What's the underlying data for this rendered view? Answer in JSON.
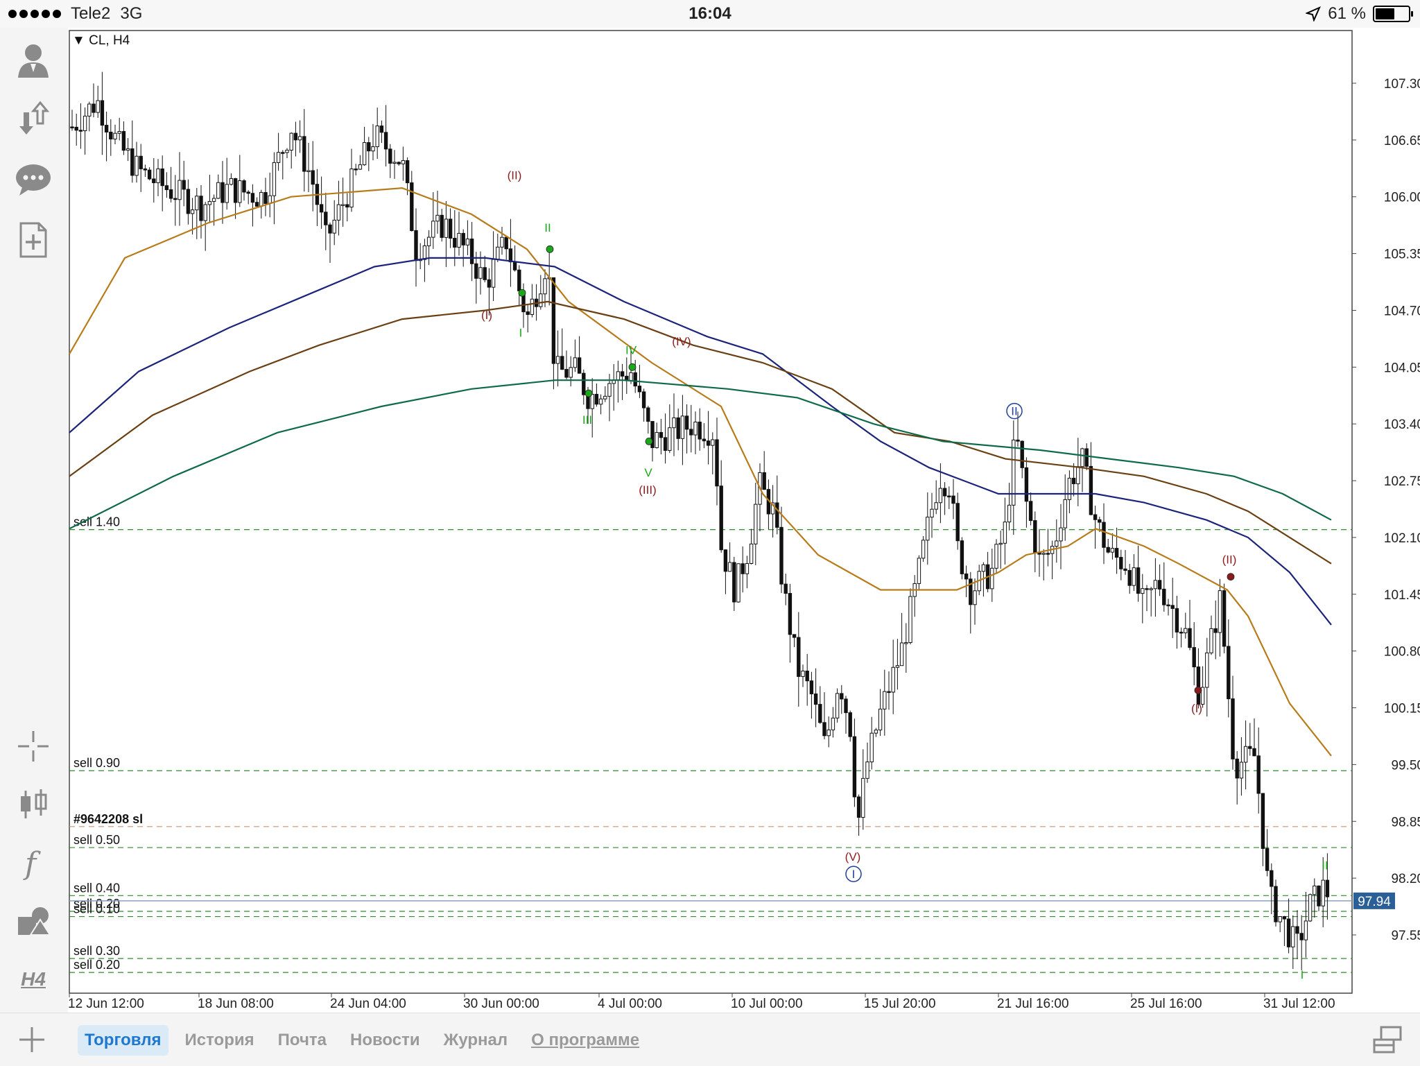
{
  "status_bar": {
    "carrier": "Tele2",
    "network": "3G",
    "time": "16:04",
    "battery": "61 %"
  },
  "chart": {
    "symbol_label": "CL, H4",
    "current_price": "97.94",
    "timeframe_button": "H4",
    "price_labels": [
      "107.30",
      "106.65",
      "106.00",
      "105.35",
      "104.70",
      "104.05",
      "103.40",
      "102.75",
      "102.10",
      "101.45",
      "100.80",
      "100.15",
      "99.50",
      "98.85",
      "98.20",
      "97.55"
    ],
    "time_labels": [
      "12 Jun 12:00",
      "18 Jun 08:00",
      "24 Jun 04:00",
      "30 Jun 00:00",
      "4 Jul 00:00",
      "10 Jul 00:00",
      "15 Jul 20:00",
      "21 Jul 16:00",
      "25 Jul 16:00",
      "31 Jul 12:00"
    ],
    "order_lines": [
      {
        "label": "sell 1.40",
        "price": 102.19
      },
      {
        "label": "sell 0.90",
        "price": 99.43
      },
      {
        "label": "#9642208 sl",
        "price": 98.79
      },
      {
        "label": "sell 0.50",
        "price": 98.55
      },
      {
        "label": "sell 0.40",
        "price": 98.0
      },
      {
        "label": "sell 0.20",
        "price": 97.82
      },
      {
        "label": "sell 0.10",
        "price": 97.76
      },
      {
        "label": "sell 0.30",
        "price": 97.28
      },
      {
        "label": "sell 0.20",
        "price": 97.12
      }
    ],
    "colors": {
      "ma_orange": "#b87b1a",
      "ma_navy": "#1b237a",
      "ma_brown": "#6a3f12",
      "ma_green": "#0f6a4c",
      "order_line": "#2f8a2f",
      "sl_line": "#d09070",
      "wave_red": "#8b1c1c",
      "wave_green": "#1aa81a",
      "wave_blue": "#1f3f9a",
      "price_tag": "#2a5f97"
    },
    "wave_labels": [
      {
        "text": "(II)",
        "color": "red"
      },
      {
        "text": "II",
        "color": "green"
      },
      {
        "text": "(I)",
        "color": "red"
      },
      {
        "text": "I",
        "color": "green"
      },
      {
        "text": "IV",
        "color": "green"
      },
      {
        "text": "(IV)",
        "color": "red"
      },
      {
        "text": "III",
        "color": "green"
      },
      {
        "text": "V",
        "color": "green"
      },
      {
        "text": "(III)",
        "color": "red"
      },
      {
        "text": "II",
        "color": "blue"
      },
      {
        "text": "(V)",
        "color": "red"
      },
      {
        "text": "I",
        "color": "blue"
      },
      {
        "text": "(II)",
        "color": "red"
      },
      {
        "text": "(I)",
        "color": "red"
      },
      {
        "text": "II",
        "color": "green"
      },
      {
        "text": "I",
        "color": "green"
      }
    ]
  },
  "bottom_tabs": [
    {
      "label": "Торговля",
      "active": true
    },
    {
      "label": "История"
    },
    {
      "label": "Почта"
    },
    {
      "label": "Новости"
    },
    {
      "label": "Журнал"
    },
    {
      "label": "О программе",
      "underline": true
    }
  ],
  "left_toolbar": [
    {
      "icon": "account-icon"
    },
    {
      "icon": "trade-arrows-icon"
    },
    {
      "icon": "chat-icon"
    },
    {
      "icon": "new-order-icon"
    },
    {
      "icon": "crosshair-icon"
    },
    {
      "icon": "candlestick-icon"
    },
    {
      "icon": "indicator-f-icon"
    },
    {
      "icon": "objects-icon"
    }
  ]
}
